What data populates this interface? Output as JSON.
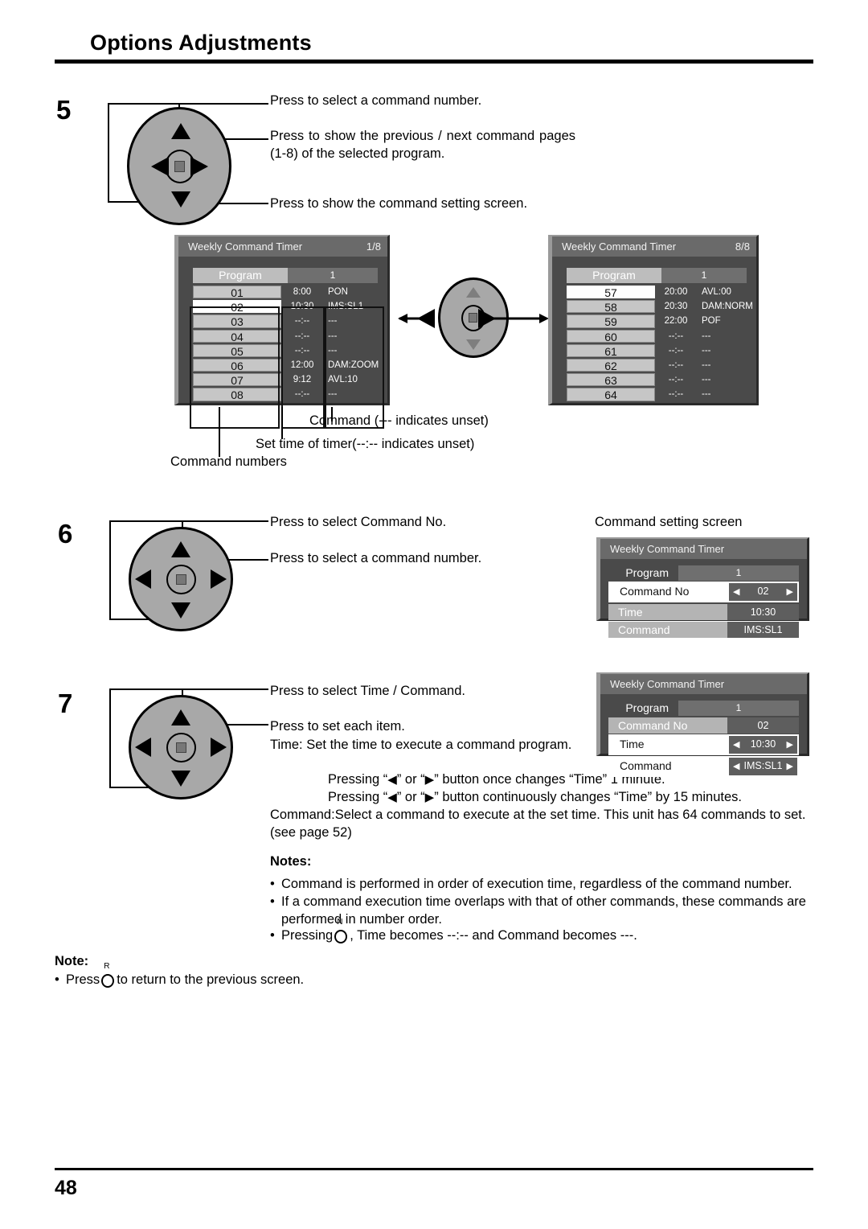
{
  "header": {
    "title": "Options Adjustments"
  },
  "page_number": "48",
  "steps": {
    "five": {
      "number": "5",
      "callouts": [
        "Press to select a command number.",
        "Press to show the previous / next command pages (1-8) of the selected program.",
        "Press to show the command setting screen."
      ]
    },
    "six": {
      "number": "6",
      "callouts": [
        "Press to select Command No.",
        "Press to select a command number."
      ],
      "screen_caption": "Command setting screen"
    },
    "seven": {
      "number": "7",
      "callouts": [
        "Press to select Time / Command.",
        "Press to set each item."
      ],
      "time_desc": "Time: Set the time to execute a command program.",
      "press_once": "button once changes “Time” 1 minute.",
      "press_cont": "button continuously changes “Time” by 15 minutes.",
      "pressing_prefix": "Pressing “",
      "or_mid": "” or “",
      "quote_close": "” ",
      "command_desc": "Command:Select a command to execute at the set time. This unit has 64 commands to set. (see page 52)"
    }
  },
  "labels": {
    "command_unset": "Command (--- indicates unset)",
    "time_unset": "Set time of timer(--:-- indicates unset)",
    "command_numbers": "Command numbers"
  },
  "notes": {
    "heading": "Notes:",
    "items": [
      "Command is performed in order of execution time, regardless of the command number.",
      "If a command execution time overlaps with that of other commands, these commands are performed in number order."
    ],
    "pressing_item": {
      "prefix": "Pressing",
      "button": "N",
      "suffix": ", Time becomes --:-- and Command becomes ---."
    }
  },
  "note_bottom": {
    "heading": "Note:",
    "prefix": "Press",
    "button": "R",
    "suffix": "to return to the previous screen."
  },
  "osd": {
    "title": "Weekly Command Timer",
    "program_label": "Program",
    "program_value": "1",
    "page_1_8": "1/8",
    "page_8_8": "8/8",
    "screen_1": {
      "rows": [
        {
          "no": "01",
          "time": "8:00",
          "cmd": "PON",
          "selected": false
        },
        {
          "no": "02",
          "time": "10:30",
          "cmd": "IMS:SL1",
          "selected": true
        },
        {
          "no": "03",
          "time": "--:--",
          "cmd": "---",
          "selected": false
        },
        {
          "no": "04",
          "time": "--:--",
          "cmd": "---",
          "selected": false
        },
        {
          "no": "05",
          "time": "--:--",
          "cmd": "---",
          "selected": false
        },
        {
          "no": "06",
          "time": "12:00",
          "cmd": "DAM:ZOOM",
          "selected": false
        },
        {
          "no": "07",
          "time": "9:12",
          "cmd": "AVL:10",
          "selected": false
        },
        {
          "no": "08",
          "time": "--:--",
          "cmd": "---",
          "selected": false
        }
      ]
    },
    "screen_8": {
      "rows": [
        {
          "no": "57",
          "time": "20:00",
          "cmd": "AVL:00",
          "selected": true
        },
        {
          "no": "58",
          "time": "20:30",
          "cmd": "DAM:NORM",
          "selected": false
        },
        {
          "no": "59",
          "time": "22:00",
          "cmd": "POF",
          "selected": false
        },
        {
          "no": "60",
          "time": "--:--",
          "cmd": "---",
          "selected": false
        },
        {
          "no": "61",
          "time": "--:--",
          "cmd": "---",
          "selected": false
        },
        {
          "no": "62",
          "time": "--:--",
          "cmd": "---",
          "selected": false
        },
        {
          "no": "63",
          "time": "--:--",
          "cmd": "---",
          "selected": false
        },
        {
          "no": "64",
          "time": "--:--",
          "cmd": "---",
          "selected": false
        }
      ]
    },
    "setting_screen_a": {
      "title": "Weekly Command Timer",
      "program_label": "Program",
      "program_value": "1",
      "rows": [
        {
          "label": "Command No",
          "value": "02",
          "highlighted": true,
          "spinner": true
        },
        {
          "label": "Time",
          "value": "10:30",
          "highlighted": false,
          "spinner": false
        },
        {
          "label": "Command",
          "value": "IMS:SL1",
          "highlighted": false,
          "spinner": false
        }
      ]
    },
    "setting_screen_b": {
      "title": "Weekly Command Timer",
      "program_label": "Program",
      "program_value": "1",
      "rows": [
        {
          "label": "Command No",
          "value": "02",
          "highlighted": false,
          "spinner": false
        },
        {
          "label": "Time",
          "value": "10:30",
          "highlighted": true,
          "spinner": true
        },
        {
          "label": "Command",
          "value": "IMS:SL1",
          "highlighted": true,
          "spinner": true
        }
      ]
    }
  },
  "colors": {
    "osd_bg": "#4a4a4a",
    "osd_title_bg": "#6a6a6a",
    "row_bg": "#c6c6c6",
    "row_selected_bg": "#ffffff",
    "dpad_fill": "#a8a8a8"
  }
}
